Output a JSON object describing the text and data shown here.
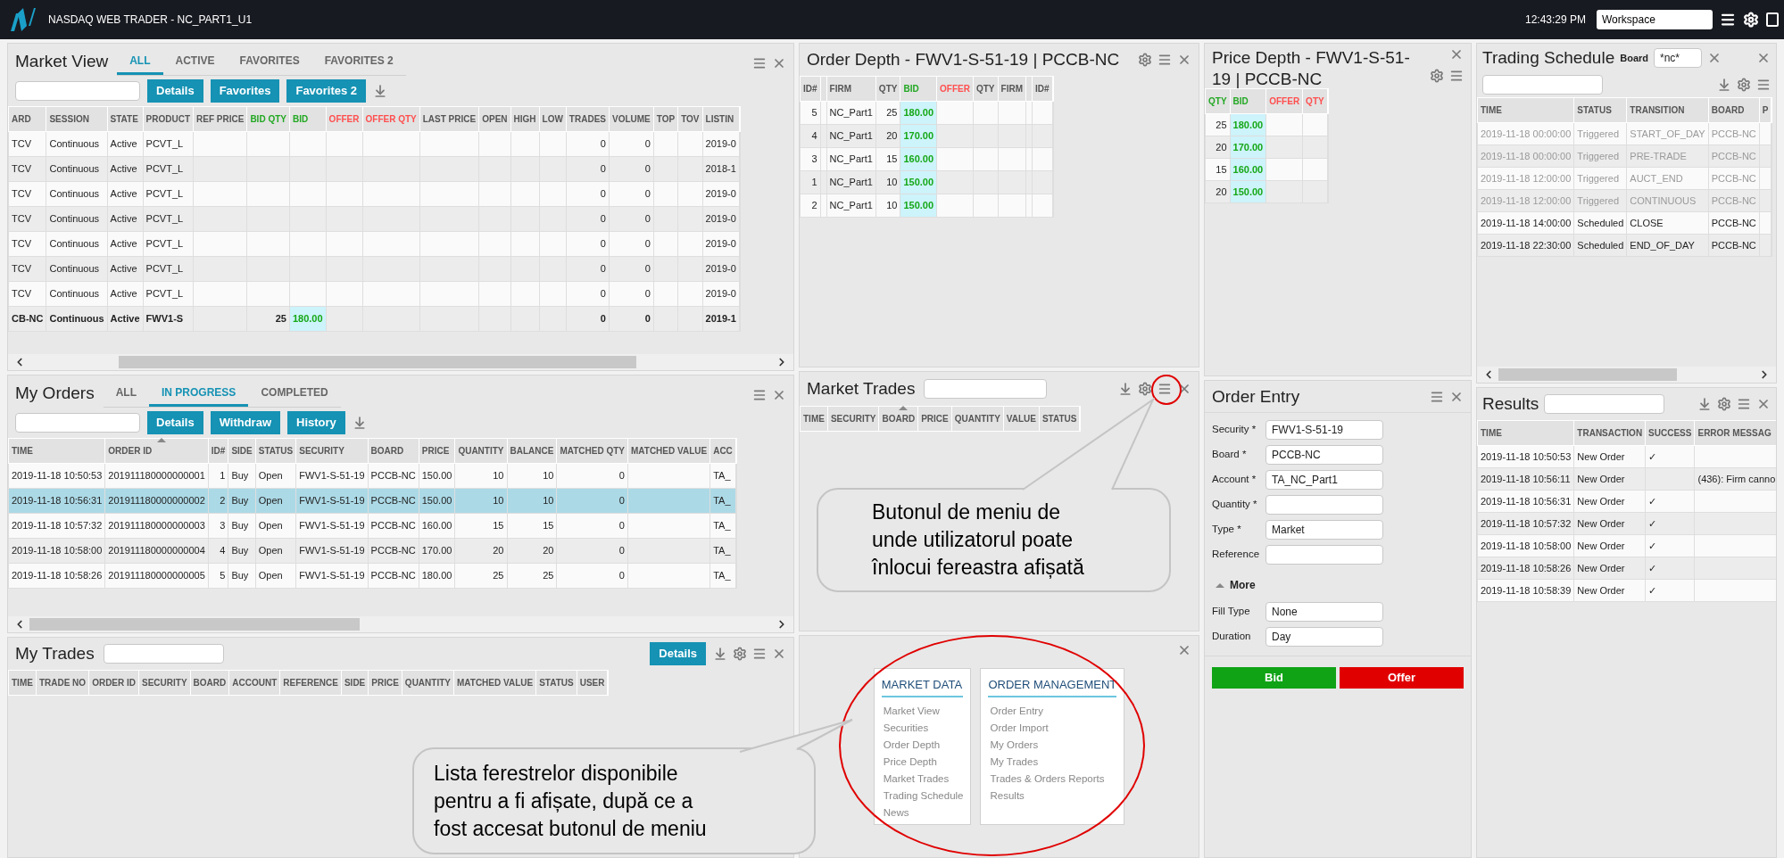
{
  "app": {
    "title": "NASDAQ WEB TRADER - NC_PART1_U1",
    "clock": "12:43:29 PM",
    "workspace": "Workspace"
  },
  "market_view": {
    "title": "Market View",
    "tabs": [
      {
        "label": "ALL",
        "selected": true
      },
      {
        "label": "ACTIVE",
        "selected": false
      },
      {
        "label": "FAVORITES",
        "selected": false
      },
      {
        "label": "FAVORITES 2",
        "selected": false
      }
    ],
    "buttons": [
      "Details",
      "Favorites",
      "Favorites 2"
    ],
    "columns": [
      {
        "label": "ARD",
        "kind": "text"
      },
      {
        "label": "SESSION",
        "kind": "text"
      },
      {
        "label": "STATE",
        "kind": "text"
      },
      {
        "label": "PRODUCT",
        "kind": "text"
      },
      {
        "label": "REF PRICE",
        "kind": "number"
      },
      {
        "label": "BID QTY",
        "kind": "bid_qty"
      },
      {
        "label": "BID",
        "kind": "bid"
      },
      {
        "label": "OFFER",
        "kind": "offer"
      },
      {
        "label": "OFFER QTY",
        "kind": "offer_qty"
      },
      {
        "label": "LAST PRICE",
        "kind": "number"
      },
      {
        "label": "OPEN",
        "kind": "number"
      },
      {
        "label": "HIGH",
        "kind": "number"
      },
      {
        "label": "LOW",
        "kind": "number"
      },
      {
        "label": "TRADES",
        "kind": "number"
      },
      {
        "label": "VOLUME",
        "kind": "number"
      },
      {
        "label": "TOP",
        "kind": "number"
      },
      {
        "label": "TOV",
        "kind": "number"
      },
      {
        "label": "LISTIN",
        "kind": "text"
      }
    ],
    "rows": [
      {
        "bold": false,
        "cells": [
          "TCV",
          "Continuous",
          "Active",
          "PCVT_L",
          null,
          null,
          null,
          null,
          null,
          null,
          null,
          null,
          null,
          "0",
          "0",
          null,
          null,
          "2019-0"
        ]
      },
      {
        "bold": false,
        "cells": [
          "TCV",
          "Continuous",
          "Active",
          "PCVT_L",
          null,
          null,
          null,
          null,
          null,
          null,
          null,
          null,
          null,
          "0",
          "0",
          null,
          null,
          "2018-1"
        ]
      },
      {
        "bold": false,
        "cells": [
          "TCV",
          "Continuous",
          "Active",
          "PCVT_L",
          null,
          null,
          null,
          null,
          null,
          null,
          null,
          null,
          null,
          "0",
          "0",
          null,
          null,
          "2019-0"
        ]
      },
      {
        "bold": false,
        "cells": [
          "TCV",
          "Continuous",
          "Active",
          "PCVT_L",
          null,
          null,
          null,
          null,
          null,
          null,
          null,
          null,
          null,
          "0",
          "0",
          null,
          null,
          "2019-0"
        ]
      },
      {
        "bold": false,
        "cells": [
          "TCV",
          "Continuous",
          "Active",
          "PCVT_L",
          null,
          null,
          null,
          null,
          null,
          null,
          null,
          null,
          null,
          "0",
          "0",
          null,
          null,
          "2019-0"
        ]
      },
      {
        "bold": false,
        "cells": [
          "TCV",
          "Continuous",
          "Active",
          "PCVT_L",
          null,
          null,
          null,
          null,
          null,
          null,
          null,
          null,
          null,
          "0",
          "0",
          null,
          null,
          "2019-0"
        ]
      },
      {
        "bold": false,
        "cells": [
          "TCV",
          "Continuous",
          "Active",
          "PCVT_L",
          null,
          null,
          null,
          null,
          null,
          null,
          null,
          null,
          null,
          "0",
          "0",
          null,
          null,
          "2019-0"
        ]
      },
      {
        "bold": true,
        "cells": [
          "CB-NC",
          "Continuous",
          "Active",
          "FWV1-S",
          null,
          "25",
          "180.00",
          null,
          null,
          null,
          null,
          null,
          null,
          "0",
          "0",
          null,
          null,
          "2019-1"
        ]
      }
    ]
  },
  "my_orders": {
    "title": "My Orders",
    "tabs": [
      {
        "label": "ALL",
        "selected": false
      },
      {
        "label": "IN PROGRESS",
        "selected": true
      },
      {
        "label": "COMPLETED",
        "selected": false
      }
    ],
    "buttons": [
      "Details",
      "Withdraw",
      "History"
    ],
    "columns": [
      {
        "label": "TIME",
        "kind": "text",
        "sorted": false
      },
      {
        "label": "ORDER ID",
        "kind": "text",
        "sorted": true
      },
      {
        "label": "ID#",
        "kind": "number",
        "sorted": false
      },
      {
        "label": "SIDE",
        "kind": "text",
        "sorted": false
      },
      {
        "label": "STATUS",
        "kind": "text",
        "sorted": false
      },
      {
        "label": "SECURITY",
        "kind": "text",
        "sorted": false
      },
      {
        "label": "BOARD",
        "kind": "text",
        "sorted": false
      },
      {
        "label": "PRICE",
        "kind": "text",
        "sorted": false
      },
      {
        "label": "QUANTITY",
        "kind": "number",
        "sorted": false
      },
      {
        "label": "BALANCE",
        "kind": "number",
        "sorted": false
      },
      {
        "label": "MATCHED QTY",
        "kind": "number",
        "sorted": false
      },
      {
        "label": "MATCHED VALUE",
        "kind": "number",
        "sorted": false
      },
      {
        "label": "ACC",
        "kind": "text",
        "sorted": false
      }
    ],
    "rows": [
      {
        "selected": false,
        "cells": [
          "2019-11-18 10:50:53",
          "201911180000000001",
          "1",
          "Buy",
          "Open",
          "FWV1-S-51-19",
          "PCCB-NC",
          "150.00",
          "10",
          "10",
          "0",
          null,
          "TA_"
        ]
      },
      {
        "selected": true,
        "cells": [
          "2019-11-18 10:56:31",
          "201911180000000002",
          "2",
          "Buy",
          "Open",
          "FWV1-S-51-19",
          "PCCB-NC",
          "150.00",
          "10",
          "10",
          "0",
          null,
          "TA_"
        ]
      },
      {
        "selected": false,
        "cells": [
          "2019-11-18 10:57:32",
          "201911180000000003",
          "3",
          "Buy",
          "Open",
          "FWV1-S-51-19",
          "PCCB-NC",
          "160.00",
          "15",
          "15",
          "0",
          null,
          "TA_"
        ]
      },
      {
        "selected": false,
        "cells": [
          "2019-11-18 10:58:00",
          "201911180000000004",
          "4",
          "Buy",
          "Open",
          "FWV1-S-51-19",
          "PCCB-NC",
          "170.00",
          "20",
          "20",
          "0",
          null,
          "TA_"
        ]
      },
      {
        "selected": false,
        "cells": [
          "2019-11-18 10:58:26",
          "201911180000000005",
          "5",
          "Buy",
          "Open",
          "FWV1-S-51-19",
          "PCCB-NC",
          "180.00",
          "25",
          "25",
          "0",
          null,
          "TA_"
        ]
      }
    ]
  },
  "my_trades": {
    "title": "My Trades",
    "button": "Details",
    "columns": [
      {
        "label": "TIME",
        "kind": "text"
      },
      {
        "label": "TRADE NO",
        "kind": "text"
      },
      {
        "label": "ORDER ID",
        "kind": "text"
      },
      {
        "label": "SECURITY",
        "kind": "text"
      },
      {
        "label": "BOARD",
        "kind": "text"
      },
      {
        "label": "ACCOUNT",
        "kind": "text"
      },
      {
        "label": "REFERENCE",
        "kind": "text"
      },
      {
        "label": "SIDE",
        "kind": "text"
      },
      {
        "label": "PRICE",
        "kind": "text"
      },
      {
        "label": "QUANTITY",
        "kind": "text"
      },
      {
        "label": "MATCHED VALUE",
        "kind": "text"
      },
      {
        "label": "STATUS",
        "kind": "text"
      },
      {
        "label": "USER",
        "kind": "text"
      }
    ]
  },
  "order_depth": {
    "title": "Order Depth - FWV1-S-51-19 | PCCB-NC",
    "columns": [
      {
        "label": "ID#",
        "kind": "number"
      },
      {
        "kind": "text"
      },
      {
        "label": "FIRM",
        "kind": "text"
      },
      {
        "label": "QTY",
        "kind": "number"
      },
      {
        "label": "BID",
        "kind": "bid"
      },
      {
        "label": "OFFER",
        "kind": "offer"
      },
      {
        "label": "QTY",
        "kind": "number"
      },
      {
        "label": "FIRM",
        "kind": "text"
      },
      {
        "kind": "text"
      },
      {
        "label": "ID#",
        "kind": "text"
      }
    ],
    "rows": [
      {
        "cells": [
          "5",
          null,
          "NC_Part1",
          "25",
          "180.00",
          null,
          null,
          null,
          null,
          null
        ]
      },
      {
        "cells": [
          "4",
          null,
          "NC_Part1",
          "20",
          "170.00",
          null,
          null,
          null,
          null,
          null
        ]
      },
      {
        "cells": [
          "3",
          null,
          "NC_Part1",
          "15",
          "160.00",
          null,
          null,
          null,
          null,
          null
        ]
      },
      {
        "cells": [
          "1",
          null,
          "NC_Part1",
          "10",
          "150.00",
          null,
          null,
          null,
          null,
          null
        ]
      },
      {
        "cells": [
          "2",
          null,
          "NC_Part1",
          "10",
          "150.00",
          null,
          null,
          null,
          null,
          null
        ]
      }
    ]
  },
  "market_trades": {
    "title": "Market Trades",
    "columns": [
      {
        "label": "TIME",
        "kind": "text",
        "sorted": false
      },
      {
        "label": "SECURITY",
        "kind": "text",
        "sorted": false
      },
      {
        "label": "BOARD",
        "kind": "text",
        "sorted": true
      },
      {
        "label": "PRICE",
        "kind": "text",
        "sorted": false
      },
      {
        "label": "QUANTITY",
        "kind": "text",
        "sorted": false
      },
      {
        "label": "VALUE",
        "kind": "text",
        "sorted": false
      },
      {
        "label": "STATUS",
        "kind": "text",
        "sorted": false
      }
    ]
  },
  "window_menu": {
    "groups": [
      {
        "title": "MARKET DATA",
        "items": [
          "Market View",
          "Securities",
          "Order Depth",
          "Price Depth",
          "Market Trades",
          "Trading Schedule",
          "News"
        ]
      },
      {
        "title": "ORDER MANAGEMENT",
        "items": [
          "Order Entry",
          "Order Import",
          "My Orders",
          "My Trades",
          "Trades & Orders Reports",
          "Results"
        ]
      }
    ]
  },
  "price_depth": {
    "title": "Price Depth - FWV1-S-51-19 | PCCB-NC",
    "columns": [
      {
        "label": "QTY",
        "kind": "bid_qty"
      },
      {
        "label": "BID",
        "kind": "bid"
      },
      {
        "label": "OFFER",
        "kind": "offer"
      },
      {
        "label": "QTY",
        "kind": "offer_qty"
      }
    ],
    "rows": [
      {
        "cells": [
          "25",
          "180.00",
          null,
          null
        ]
      },
      {
        "cells": [
          "20",
          "170.00",
          null,
          null
        ]
      },
      {
        "cells": [
          "15",
          "160.00",
          null,
          null
        ]
      },
      {
        "cells": [
          "20",
          "150.00",
          null,
          null
        ]
      }
    ]
  },
  "order_entry": {
    "title": "Order Entry",
    "fields": [
      {
        "label": "Security *",
        "value": "FWV1-S-51-19"
      },
      {
        "label": "Board *",
        "value": "PCCB-NC"
      },
      {
        "label": "Account *",
        "value": "TA_NC_Part1"
      },
      {
        "label": "Quantity *"
      },
      {
        "label": "Type *",
        "value": "Market"
      },
      {
        "label": "Reference"
      }
    ],
    "more": {
      "label": "More",
      "expanded": true
    },
    "more_fields": [
      {
        "label": "Fill Type",
        "value": "None"
      },
      {
        "label": "Duration",
        "value": "Day"
      }
    ],
    "buttons": [
      {
        "label": "Bid",
        "kind": "bid"
      },
      {
        "label": "Offer",
        "kind": "offer"
      }
    ]
  },
  "trading_schedule": {
    "title": "Trading Schedule",
    "board_label": "Board",
    "board_filter": "*nc*",
    "columns": [
      {
        "label": "TIME",
        "kind": "text"
      },
      {
        "label": "STATUS",
        "kind": "text"
      },
      {
        "label": "TRANSITION",
        "kind": "text"
      },
      {
        "label": "BOARD",
        "kind": "text"
      },
      {
        "label": "P",
        "kind": "text"
      }
    ],
    "rows": [
      {
        "dim": true,
        "cells": [
          "2019-11-18 00:00:00",
          "Triggered",
          "START_OF_DAY",
          "PCCB-NC",
          null
        ]
      },
      {
        "dim": true,
        "cells": [
          "2019-11-18 00:00:00",
          "Triggered",
          "PRE-TRADE",
          "PCCB-NC",
          null
        ]
      },
      {
        "dim": true,
        "cells": [
          "2019-11-18 12:00:00",
          "Triggered",
          "AUCT_END",
          "PCCB-NC",
          null
        ]
      },
      {
        "dim": true,
        "cells": [
          "2019-11-18 12:00:00",
          "Triggered",
          "CONTINUOUS",
          "PCCB-NC",
          null
        ]
      },
      {
        "dim": false,
        "cells": [
          "2019-11-18 14:00:00",
          "Scheduled",
          "CLOSE",
          "PCCB-NC",
          null
        ]
      },
      {
        "dim": false,
        "cells": [
          "2019-11-18 22:30:00",
          "Scheduled",
          "END_OF_DAY",
          "PCCB-NC",
          null
        ]
      }
    ]
  },
  "results": {
    "title": "Results",
    "columns": [
      {
        "label": "TIME",
        "kind": "text"
      },
      {
        "label": "TRANSACTION",
        "kind": "text"
      },
      {
        "label": "SUCCESS",
        "kind": "text"
      },
      {
        "label": "ERROR MESSAG",
        "kind": "text"
      }
    ],
    "rows": [
      {
        "cells": [
          "2019-11-18 10:50:53",
          "New Order",
          "✓",
          null
        ]
      },
      {
        "cells": [
          "2019-11-18 10:56:11",
          "New Order",
          null,
          "(436): Firm canno"
        ]
      },
      {
        "cells": [
          "2019-11-18 10:56:31",
          "New Order",
          "✓",
          null
        ]
      },
      {
        "cells": [
          "2019-11-18 10:57:32",
          "New Order",
          "✓",
          null
        ]
      },
      {
        "cells": [
          "2019-11-18 10:58:00",
          "New Order",
          "✓",
          null
        ]
      },
      {
        "cells": [
          "2019-11-18 10:58:26",
          "New Order",
          "✓",
          null
        ]
      },
      {
        "cells": [
          "2019-11-18 10:58:39",
          "New Order",
          "✓",
          null
        ]
      }
    ]
  },
  "callouts": [
    {
      "kind": "menu_button",
      "lines": [
        "Butonul de meniu de",
        "unde utilizatorul poate",
        "înlocui fereastra afișată"
      ]
    },
    {
      "kind": "window_list",
      "lines": [
        "Lista ferestrelor disponibile",
        "pentru a fi afișate, după ce a",
        "fost accesat butonul de meniu"
      ]
    }
  ]
}
